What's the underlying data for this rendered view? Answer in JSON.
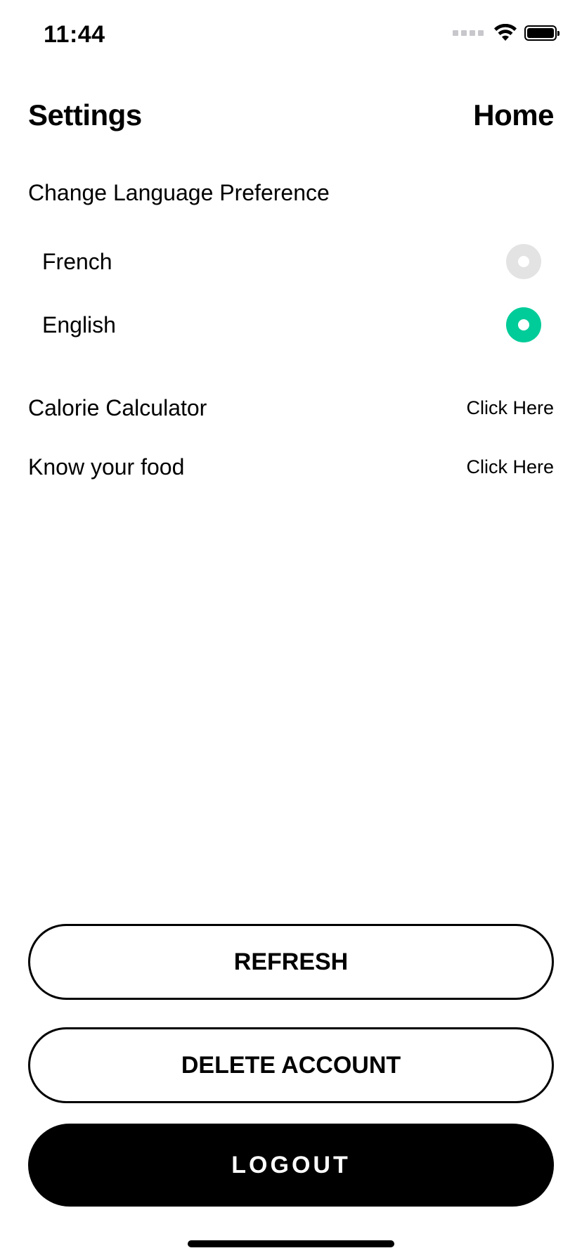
{
  "status_bar": {
    "time": "11:44"
  },
  "header": {
    "title": "Settings",
    "home_label": "Home"
  },
  "language": {
    "section_label": "Change Language Preference",
    "options": [
      {
        "label": "French",
        "selected": false
      },
      {
        "label": "English",
        "selected": true
      }
    ]
  },
  "links": [
    {
      "label": "Calorie Calculator",
      "action": "Click Here"
    },
    {
      "label": "Know your food",
      "action": "Click Here"
    }
  ],
  "buttons": {
    "refresh": "REFRESH",
    "delete_account": "DELETE ACCOUNT",
    "logout": "LOGOUT"
  },
  "colors": {
    "accent": "#00cc99",
    "radio_unselected": "#e3e3e3",
    "primary": "#000000"
  },
  "icons": {
    "signal": "cellular-signal-icon",
    "wifi": "wifi-icon",
    "battery": "battery-icon"
  }
}
